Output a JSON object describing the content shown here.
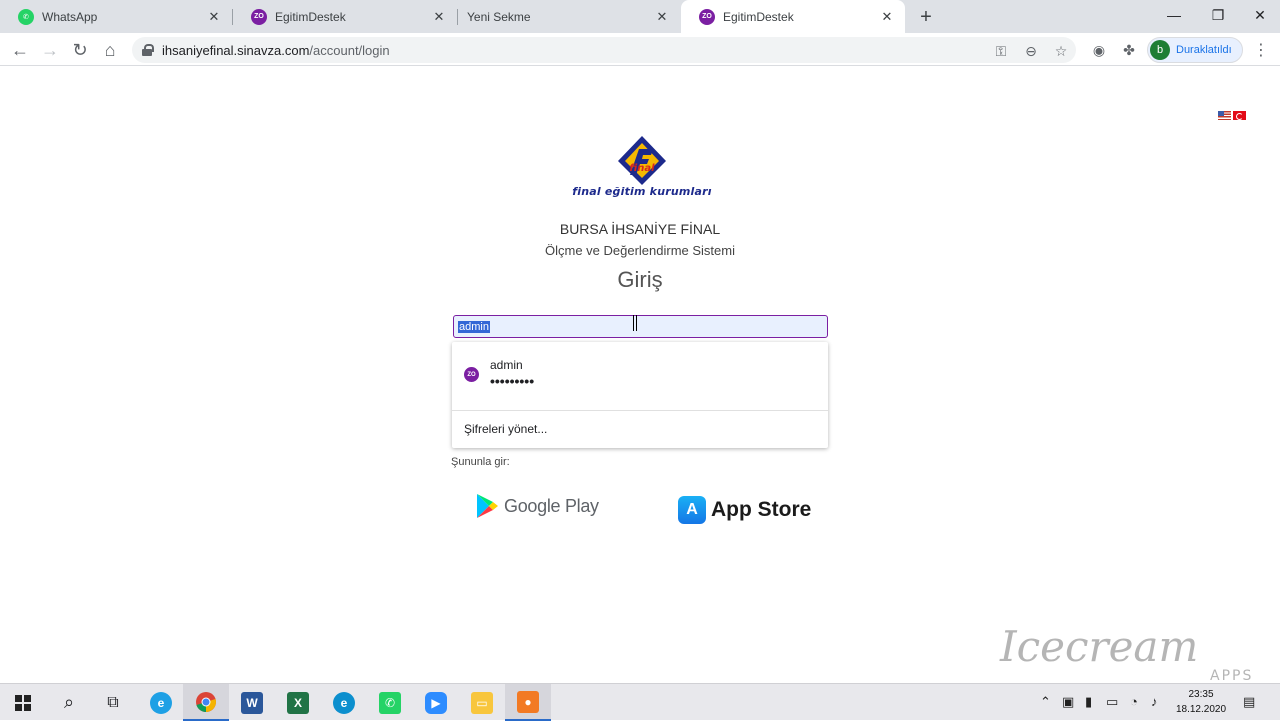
{
  "browser": {
    "tabs": [
      {
        "title": "WhatsApp",
        "favicon": "whatsapp-icon",
        "color": "#25D366",
        "active": false
      },
      {
        "title": "EgitimDestek",
        "favicon": "zo-icon",
        "color": "#7b1fa2",
        "active": false
      },
      {
        "title": "Yeni Sekme",
        "favicon": "",
        "color": "",
        "active": false
      },
      {
        "title": "EgitimDestek",
        "favicon": "zo-icon",
        "color": "#7b1fa2",
        "active": true
      }
    ],
    "favicon_text": "ZO",
    "url_host": "ihsaniyefinal.sinavza.com",
    "url_path": "/account/login",
    "profile_initial": "b",
    "profile_label": "Duraklatıldı"
  },
  "page": {
    "logo_text": "final eğitim kurumları",
    "org_name": "BURSA İHSANİYE FİNAL",
    "subtitle": "Ölçme ve Değerlendirme Sistemi",
    "heading": "Giriş",
    "username_value": "admin",
    "autofill": {
      "icon_text": "ZO",
      "username": "admin",
      "password_mask": "•••••••••",
      "manage_label": "Şifreleri yönet..."
    },
    "signin_with": "Şununla gir:",
    "google_play_label": "Google Play",
    "app_store_label": "App Store",
    "app_store_glyph": "A"
  },
  "watermark": {
    "script": "Icecream",
    "sub": "APPS"
  },
  "taskbar": {
    "time": "23:35",
    "date": "18.12.2020",
    "apps": [
      "start",
      "search",
      "task-view",
      "internet-explorer",
      "chrome",
      "word",
      "excel",
      "edge",
      "whatsapp",
      "zoom",
      "file-explorer",
      "icecream-recorder"
    ]
  },
  "colors": {
    "accent": "#7b1fa2",
    "selection": "#3367d6",
    "autofill_bg": "#e8f0fe"
  }
}
